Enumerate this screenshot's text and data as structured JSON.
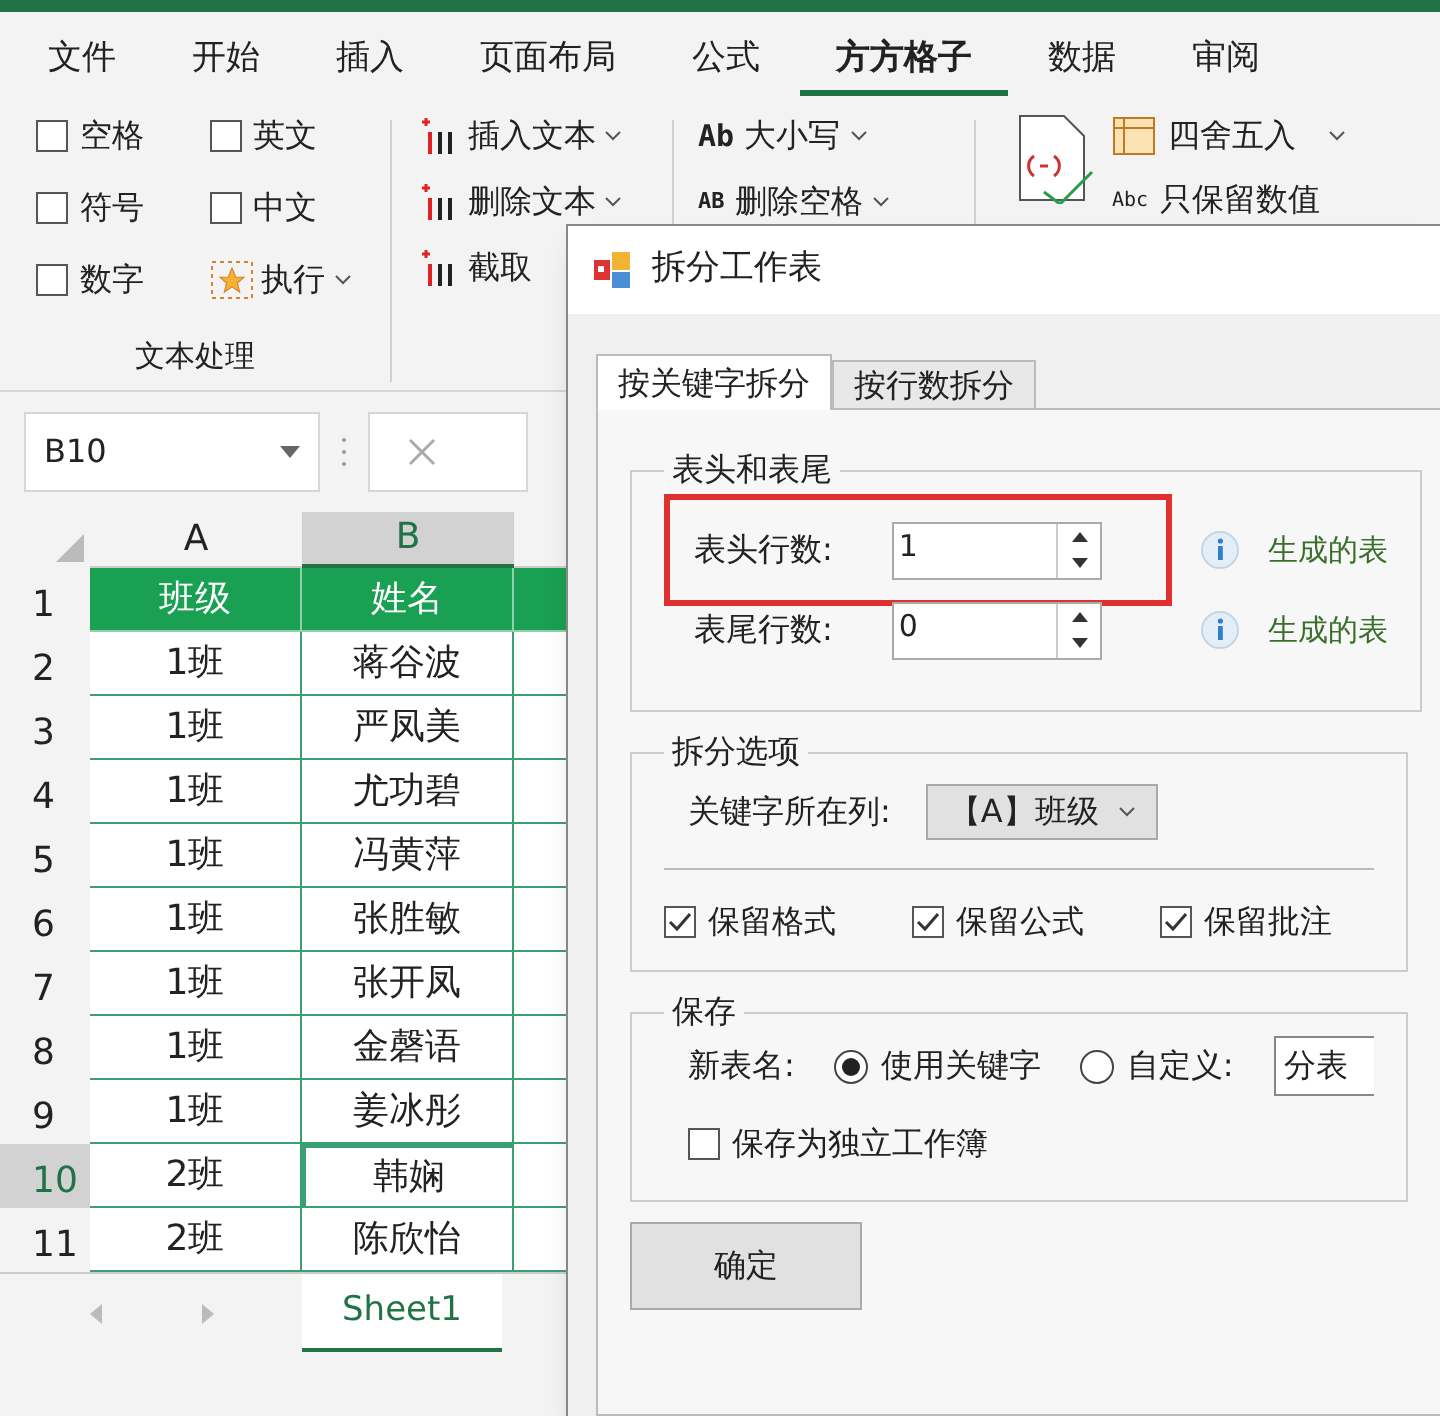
{
  "menu_tabs": [
    {
      "label": "文件",
      "selected": false
    },
    {
      "label": "开始",
      "selected": false
    },
    {
      "label": "插入",
      "selected": false
    },
    {
      "label": "页面布局",
      "selected": false
    },
    {
      "label": "公式",
      "selected": false
    },
    {
      "label": "方方格子",
      "selected": true
    },
    {
      "label": "数据",
      "selected": false
    },
    {
      "label": "审阅",
      "selected": false
    }
  ],
  "ribbon": {
    "checkboxes": [
      {
        "label": "空格",
        "checked": false
      },
      {
        "label": "英文",
        "checked": false
      },
      {
        "label": "符号",
        "checked": false
      },
      {
        "label": "中文",
        "checked": false
      },
      {
        "label": "数字",
        "checked": false
      }
    ],
    "execute": "执行",
    "group_label": "文本处理",
    "text_buttons": [
      {
        "label": "插入文本"
      },
      {
        "label": "删除文本"
      },
      {
        "label": "截取"
      }
    ],
    "case_buttons": [
      {
        "icon_text": "Ab",
        "label": "大小写"
      },
      {
        "icon_text": "AB",
        "label": "删除空格"
      }
    ],
    "number_buttons": [
      {
        "label": "四舍五入"
      },
      {
        "icon_text": "Abc",
        "label": "只保留数值"
      }
    ]
  },
  "formula_bar": {
    "name_box": "B10"
  },
  "sheet": {
    "columns": [
      {
        "label": "A",
        "selected": false
      },
      {
        "label": "B",
        "selected": true
      }
    ],
    "rows": [
      {
        "number": "1",
        "selected": false,
        "cells": [
          "班级",
          "姓名"
        ]
      },
      {
        "number": "2",
        "selected": false,
        "cells": [
          "1班",
          "蒋谷波"
        ]
      },
      {
        "number": "3",
        "selected": false,
        "cells": [
          "1班",
          "严凤美"
        ]
      },
      {
        "number": "4",
        "selected": false,
        "cells": [
          "1班",
          "尤功碧"
        ]
      },
      {
        "number": "5",
        "selected": false,
        "cells": [
          "1班",
          "冯黄萍"
        ]
      },
      {
        "number": "6",
        "selected": false,
        "cells": [
          "1班",
          "张胜敏"
        ]
      },
      {
        "number": "7",
        "selected": false,
        "cells": [
          "1班",
          "张开凤"
        ]
      },
      {
        "number": "8",
        "selected": false,
        "cells": [
          "1班",
          "金磬语"
        ]
      },
      {
        "number": "9",
        "selected": false,
        "cells": [
          "1班",
          "姜冰彤"
        ]
      },
      {
        "number": "10",
        "selected": true,
        "cells": [
          "2班",
          "韩娴"
        ]
      },
      {
        "number": "11",
        "selected": false,
        "cells": [
          "2班",
          "陈欣怡"
        ]
      }
    ],
    "sheet_tabs": [
      {
        "label": "Sheet1",
        "selected": true
      }
    ]
  },
  "dialog": {
    "title": "拆分工作表",
    "tabs": [
      {
        "label": "按关键字拆分",
        "selected": true
      },
      {
        "label": "按行数拆分",
        "selected": false
      }
    ],
    "header_footer": {
      "title": "表头和表尾",
      "fields": [
        {
          "label": "表头行数:",
          "value": "1",
          "highlighted": true,
          "hint": "生成的表"
        },
        {
          "label": "表尾行数:",
          "value": "0",
          "highlighted": false,
          "hint": "生成的表"
        }
      ]
    },
    "options": {
      "title": "拆分选项",
      "key_column_label": "关键字所在列:",
      "key_column_value": "【A】班级",
      "checkboxes": [
        {
          "label": "保留格式",
          "checked": true
        },
        {
          "label": "保留公式",
          "checked": true
        },
        {
          "label": "保留批注",
          "checked": true
        }
      ]
    },
    "save": {
      "title": "保存",
      "name_label": "新表名:",
      "radios": [
        {
          "label": "使用关键字",
          "selected": true
        },
        {
          "label": "自定义:",
          "selected": false
        }
      ],
      "custom_value": "分表",
      "separate_workbook": {
        "label": "保存为独立工作簿",
        "checked": false
      }
    },
    "ok_button": "确定"
  }
}
